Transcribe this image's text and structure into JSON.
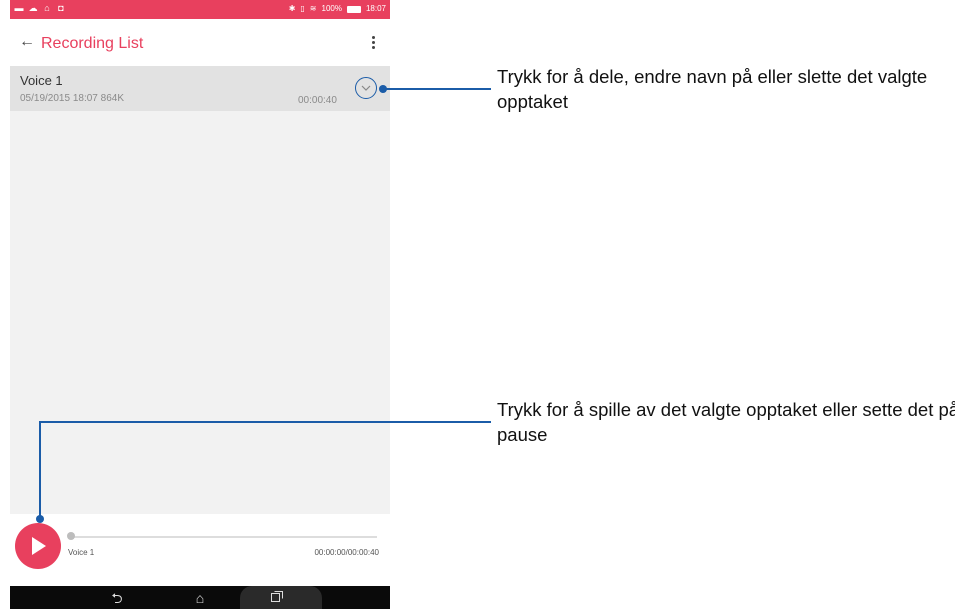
{
  "status_bar": {
    "battery": "100%",
    "time": "18:07",
    "left_icons": [
      "notification-icon",
      "cloud-icon",
      "lock-icon",
      "app-icon"
    ],
    "right_icons": [
      "bluetooth-icon",
      "vibrate-icon",
      "wifi-icon",
      "battery-icon"
    ]
  },
  "app_bar": {
    "title": "Recording List"
  },
  "recordings": [
    {
      "name": "Voice 1",
      "meta": "05/19/2015 18:07  864K",
      "duration": "00:00:40"
    }
  ],
  "player": {
    "track_name": "Voice 1",
    "time": "00:00:00/00:00:40",
    "progress": 0
  },
  "callouts": {
    "expand": "Trykk for å dele, endre navn på eller slette det valgte opptaket",
    "play": "Trykk for å spille av det valgte opptaket eller sette det på pause"
  },
  "colors": {
    "accent": "#e8405e",
    "callout": "#1b5ca8",
    "list_bg": "#f2f2f2",
    "selected_row": "#e2e2e2"
  }
}
